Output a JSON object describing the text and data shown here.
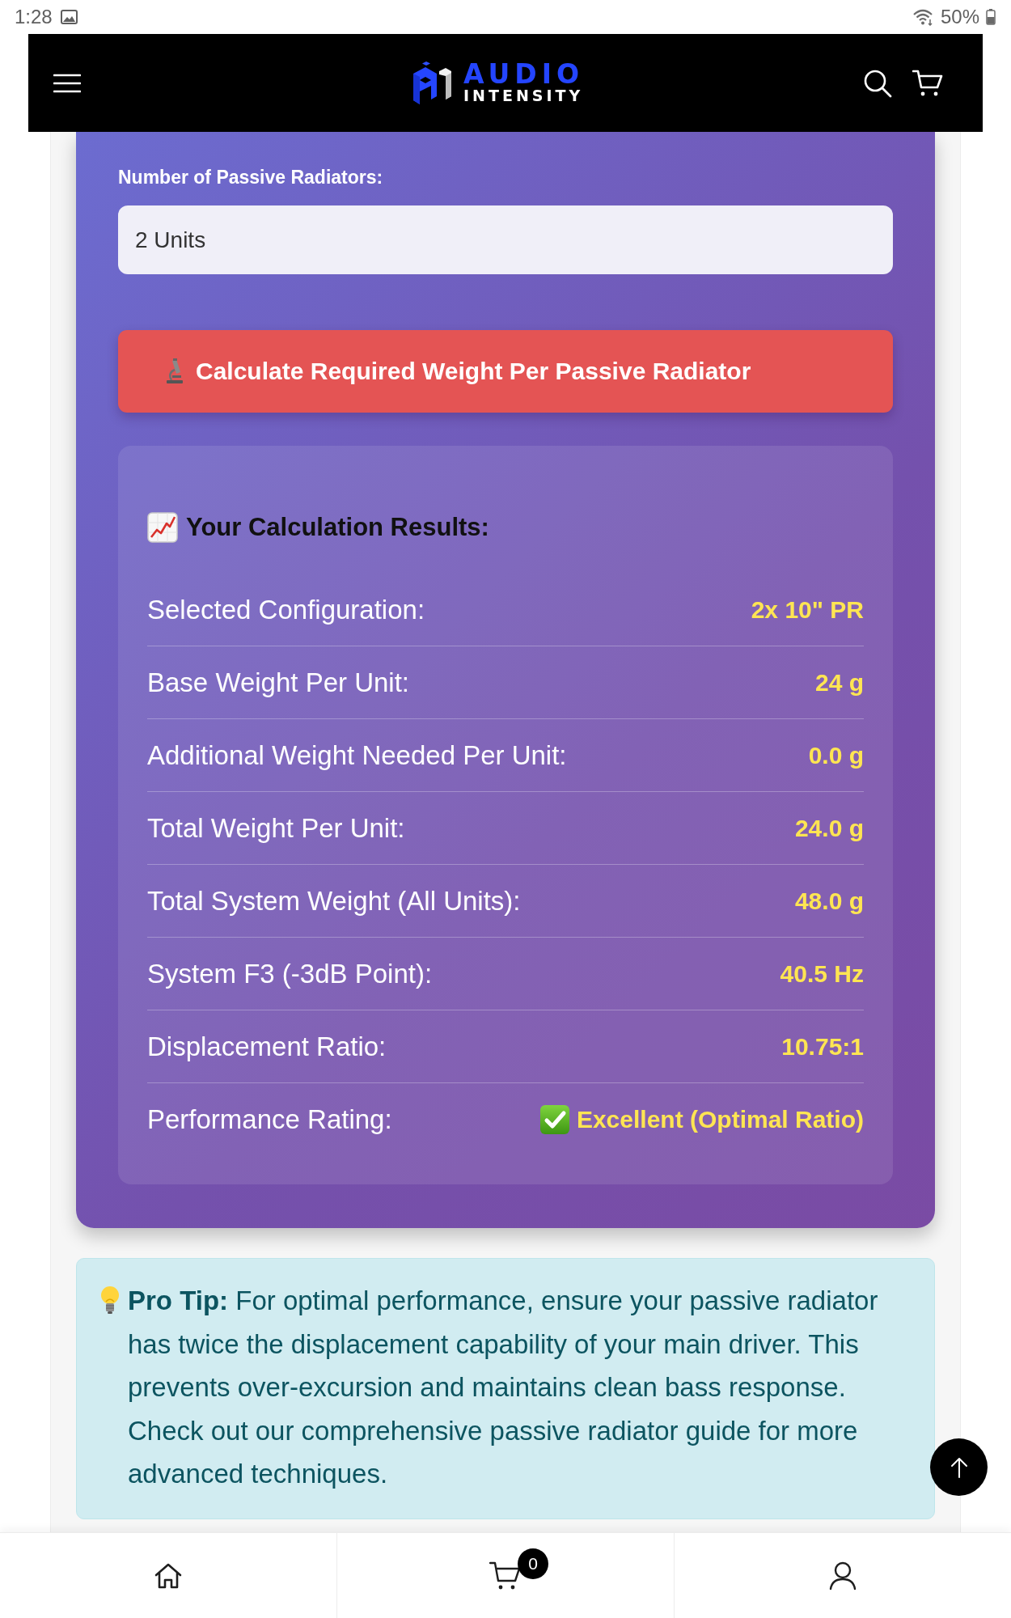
{
  "status_bar": {
    "time": "1:28",
    "battery": "50%"
  },
  "header": {
    "logo": {
      "line_1": "AUDIO",
      "line_2": "INTENSITY"
    }
  },
  "calculator": {
    "count_field": {
      "label": "Number of Passive Radiators:",
      "value": "2 Units"
    },
    "calculate_button": {
      "label": "Calculate Required Weight Per Passive Radiator"
    },
    "results": {
      "heading": "Your Calculation Results:",
      "rows": [
        {
          "kind": "value",
          "label": "Selected Configuration:",
          "value": "2x 10\" PR"
        },
        {
          "kind": "value",
          "label": "Base Weight Per Unit:",
          "value": "24 g"
        },
        {
          "kind": "value",
          "label": "Additional Weight Needed Per Unit:",
          "value": "0.0 g"
        },
        {
          "kind": "value",
          "label": "Total Weight Per Unit:",
          "value": "24.0 g"
        },
        {
          "kind": "value",
          "label": "Total System Weight (All Units):",
          "value": "48.0 g"
        },
        {
          "kind": "value",
          "label": "System F3 (-3dB Point):",
          "value": "40.5 Hz"
        },
        {
          "kind": "value",
          "label": "Displacement Ratio:",
          "value": "10.75:1"
        },
        {
          "kind": "rating",
          "label": "Performance Rating:",
          "value": "Excellent (Optimal Ratio)"
        }
      ]
    }
  },
  "pro_tip": {
    "text": "**Pro Tip:** For optimal performance, ensure your passive radiator has twice the displacement capability of your main driver. This prevents over-excursion and maintains clean bass response. Check out our comprehensive passive radiator guide for more advanced techniques."
  },
  "bottom_nav": {
    "cart_count": "0"
  }
}
